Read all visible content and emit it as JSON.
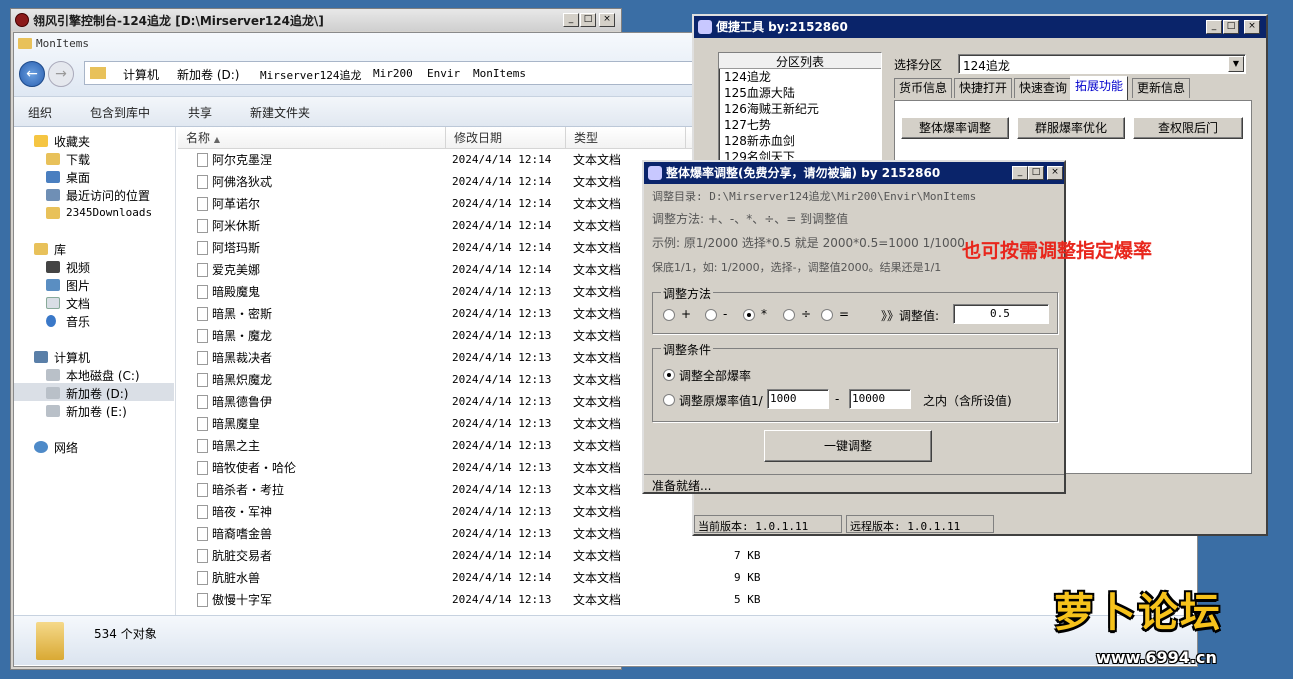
{
  "explorer": {
    "title": "翎风引擎控制台-124追龙 [D:\\Mirserver124追龙\\]",
    "window_caption": "MonItems",
    "breadcrumb": [
      "计算机",
      "新加卷 (D:)",
      "Mirserver124追龙",
      "Mir200",
      "Envir",
      "MonItems"
    ],
    "toolbar": {
      "organize": "组织",
      "include": "包含到库中",
      "share": "共享",
      "new_folder": "新建文件夹"
    },
    "nav": {
      "favorites": "收藏夹",
      "downloads": "下载",
      "desktop": "桌面",
      "recent": "最近访问的位置",
      "d2345": "2345Downloads",
      "libraries": "库",
      "videos": "视频",
      "pictures": "图片",
      "docs": "文档",
      "music": "音乐",
      "computer": "计算机",
      "disk_c": "本地磁盘 (C:)",
      "disk_d": "新加卷 (D:)",
      "disk_e": "新加卷 (E:)",
      "network": "网络"
    },
    "columns": {
      "name": "名称",
      "date": "修改日期",
      "type": "类型"
    },
    "files": [
      {
        "name": "阿尔克墨涅",
        "date": "2024/4/14 12:14",
        "type": "文本文档",
        "size": ""
      },
      {
        "name": "阿佛洛狄忒",
        "date": "2024/4/14 12:14",
        "type": "文本文档",
        "size": ""
      },
      {
        "name": "阿革诺尔",
        "date": "2024/4/14 12:14",
        "type": "文本文档",
        "size": ""
      },
      {
        "name": "阿米休斯",
        "date": "2024/4/14 12:14",
        "type": "文本文档",
        "size": ""
      },
      {
        "name": "阿塔玛斯",
        "date": "2024/4/14 12:14",
        "type": "文本文档",
        "size": ""
      },
      {
        "name": "爱克美娜",
        "date": "2024/4/14 12:14",
        "type": "文本文档",
        "size": ""
      },
      {
        "name": "暗殿魔鬼",
        "date": "2024/4/14 12:13",
        "type": "文本文档",
        "size": ""
      },
      {
        "name": "暗黑・密斯",
        "date": "2024/4/14 12:13",
        "type": "文本文档",
        "size": ""
      },
      {
        "name": "暗黑・魔龙",
        "date": "2024/4/14 12:13",
        "type": "文本文档",
        "size": ""
      },
      {
        "name": "暗黑裁决者",
        "date": "2024/4/14 12:13",
        "type": "文本文档",
        "size": ""
      },
      {
        "name": "暗黑炽魔龙",
        "date": "2024/4/14 12:13",
        "type": "文本文档",
        "size": ""
      },
      {
        "name": "暗黑德鲁伊",
        "date": "2024/4/14 12:13",
        "type": "文本文档",
        "size": ""
      },
      {
        "name": "暗黑魔皇",
        "date": "2024/4/14 12:13",
        "type": "文本文档",
        "size": ""
      },
      {
        "name": "暗黑之主",
        "date": "2024/4/14 12:13",
        "type": "文本文档",
        "size": ""
      },
      {
        "name": "暗牧使者・哈伦",
        "date": "2024/4/14 12:13",
        "type": "文本文档",
        "size": ""
      },
      {
        "name": "暗杀者・考拉",
        "date": "2024/4/14 12:13",
        "type": "文本文档",
        "size": ""
      },
      {
        "name": "暗夜・军神",
        "date": "2024/4/14 12:13",
        "type": "文本文档",
        "size": ""
      },
      {
        "name": "暗裔嗜金兽",
        "date": "2024/4/14 12:13",
        "type": "文本文档",
        "size": ""
      },
      {
        "name": "肮脏交易者",
        "date": "2024/4/14 12:14",
        "type": "文本文档",
        "size": "7 KB"
      },
      {
        "name": "肮脏水兽",
        "date": "2024/4/14 12:14",
        "type": "文本文档",
        "size": "9 KB"
      },
      {
        "name": "傲慢十字军",
        "date": "2024/4/14 12:13",
        "type": "文本文档",
        "size": "5 KB"
      }
    ],
    "status": "534 个对象"
  },
  "tools": {
    "title": "便捷工具   by:2152860",
    "partition_header": "分区列表",
    "partitions": [
      "124追龙",
      "125血源大陆",
      "126海贼王新纪元",
      "127七势",
      "128新赤血剑",
      "129名剑天下"
    ],
    "select_label": "选择分区",
    "select_value": "124追龙",
    "tabs": [
      "货币信息",
      "快捷打开",
      "快速查询",
      "拓展功能",
      "更新信息"
    ],
    "buttons": [
      "整体爆率调整",
      "群服爆率优化",
      "查权限后门"
    ],
    "current_version": "当前版本: 1.0.1.11",
    "remote_version": "远程版本: 1.0.1.11"
  },
  "adjust": {
    "title": "整体爆率调整(免费分享，请勿被骗)    by 2152860",
    "dir": "调整目录: D:\\Mirserver124追龙\\Mir200\\Envir\\MonItems",
    "method_line": "调整方法: +、-、*、÷、=   到调整值",
    "example": "示例: 原1/2000 选择*0.5 就是 2000*0.5=1000  1/1000",
    "keep": "保底1/1，如: 1/2000，选择-，调整值2000。结果还是1/1",
    "method_group": "调整方法",
    "ops": [
      "+",
      "-",
      "*",
      "÷",
      "="
    ],
    "selected_op": "*",
    "value_label": "》》调整值:",
    "value": "0.5",
    "cond_group": "调整条件",
    "cond_all": "调整全部爆率",
    "cond_range": "调整原爆率值1/",
    "range_from": "1000",
    "range_to": "10000",
    "range_sep": "-",
    "range_note": "之内（含所设值)",
    "run_button": "一键调整",
    "status": "准备就绪..."
  },
  "annotation": "也可按需调整指定爆率",
  "watermark": {
    "brand": "萝卜论坛",
    "url": "www.6994.cn"
  }
}
